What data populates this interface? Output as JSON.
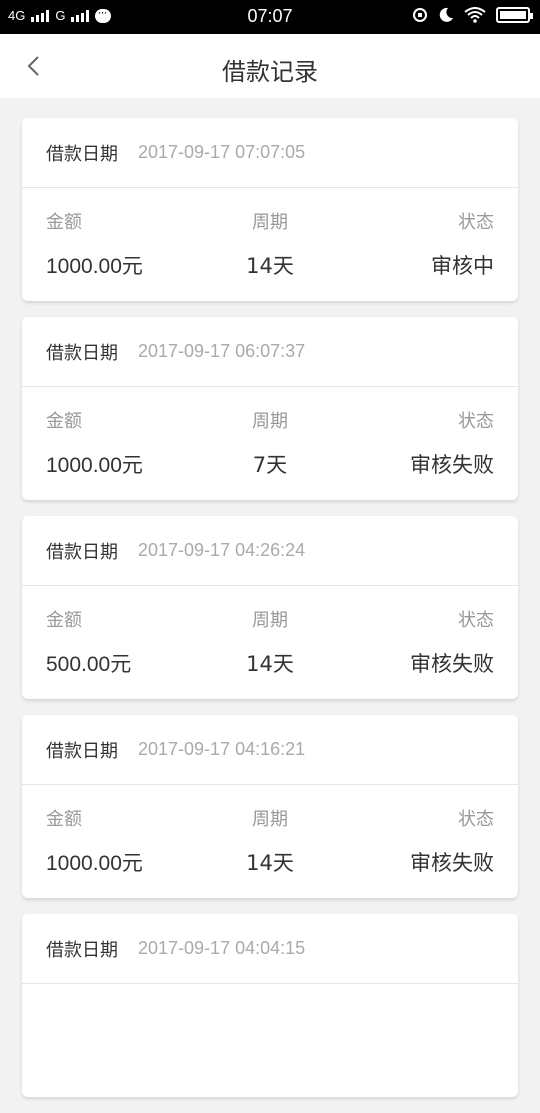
{
  "status_bar": {
    "network_1": "4G",
    "network_2": "G",
    "time": "07:07"
  },
  "header": {
    "title": "借款记录"
  },
  "records": [
    {
      "date_label": "借款日期",
      "date": "2017-09-17 07:07:05",
      "amount_label": "金额",
      "amount": "1000.00元",
      "period_label": "周期",
      "period": "14天",
      "status_label": "状态",
      "status": "审核中"
    },
    {
      "date_label": "借款日期",
      "date": "2017-09-17 06:07:37",
      "amount_label": "金额",
      "amount": "1000.00元",
      "period_label": "周期",
      "period": "7天",
      "status_label": "状态",
      "status": "审核失败"
    },
    {
      "date_label": "借款日期",
      "date": "2017-09-17 04:26:24",
      "amount_label": "金额",
      "amount": "500.00元",
      "period_label": "周期",
      "period": "14天",
      "status_label": "状态",
      "status": "审核失败"
    },
    {
      "date_label": "借款日期",
      "date": "2017-09-17 04:16:21",
      "amount_label": "金额",
      "amount": "1000.00元",
      "period_label": "周期",
      "period": "14天",
      "status_label": "状态",
      "status": "审核失败"
    },
    {
      "date_label": "借款日期",
      "date": "2017-09-17 04:04:15",
      "amount_label": "",
      "amount": "",
      "period_label": "",
      "period": "",
      "status_label": "",
      "status": ""
    }
  ]
}
